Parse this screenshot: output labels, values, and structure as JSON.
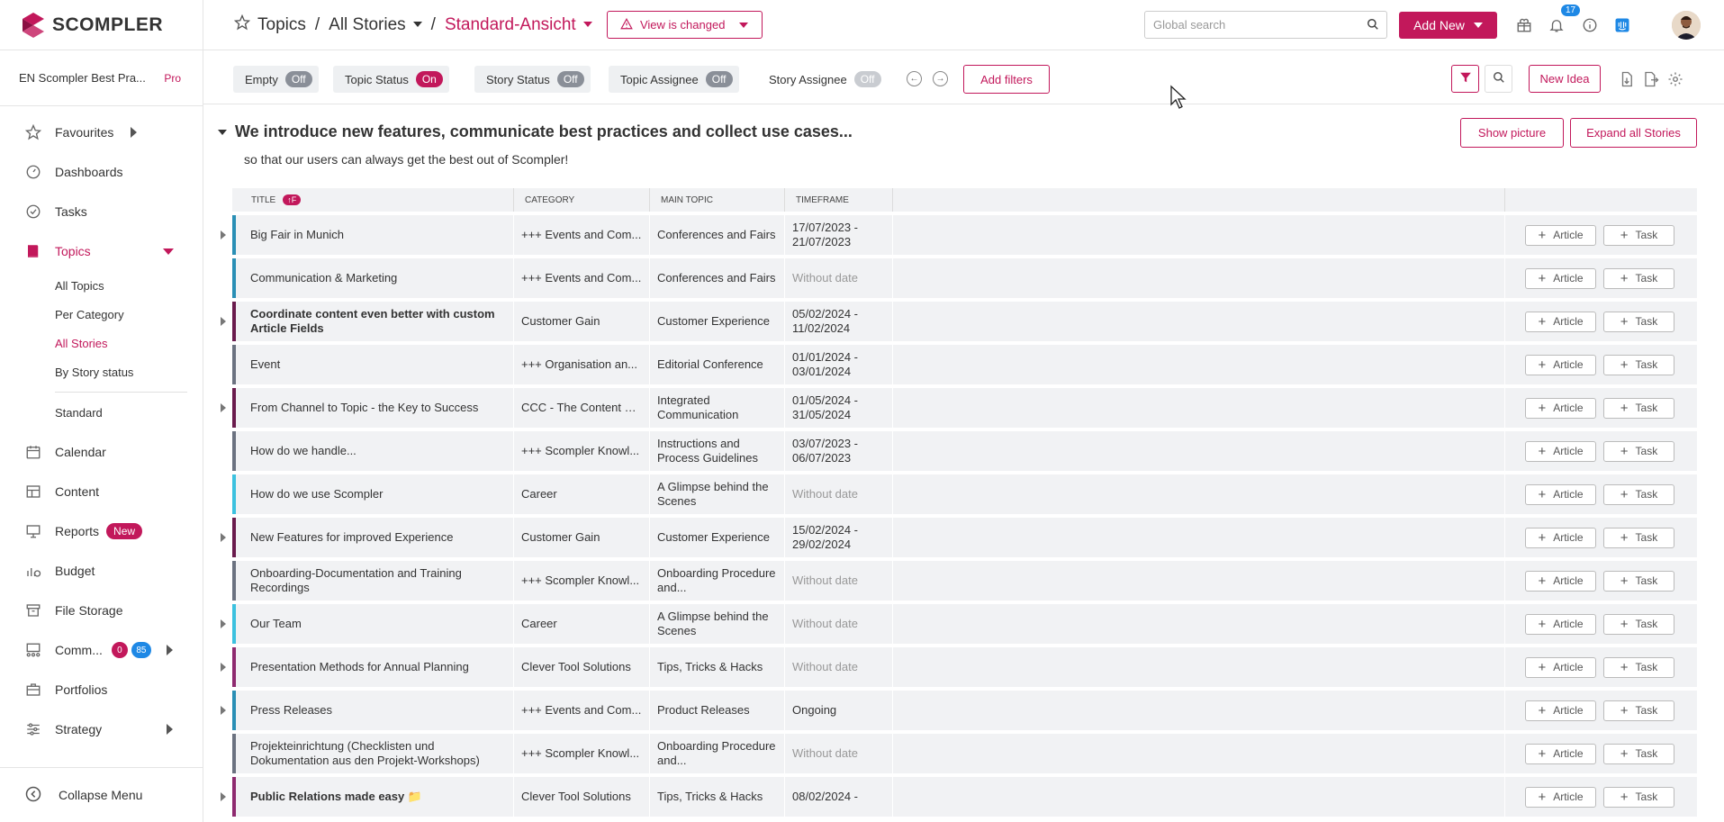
{
  "app": {
    "logo_text": "SCOMPLER"
  },
  "workspace": {
    "name": "EN Scompler Best Pra...",
    "plan": "Pro"
  },
  "sidebar": {
    "items": [
      {
        "label": "Favourites"
      },
      {
        "label": "Dashboards"
      },
      {
        "label": "Tasks"
      },
      {
        "label": "Topics"
      },
      {
        "label": "Calendar"
      },
      {
        "label": "Content"
      },
      {
        "label": "Reports",
        "badge": "New"
      },
      {
        "label": "Budget"
      },
      {
        "label": "File Storage"
      },
      {
        "label": "Comm...",
        "badge_a": "0",
        "badge_b": "85"
      },
      {
        "label": "Portfolios"
      },
      {
        "label": "Strategy"
      }
    ],
    "topics_sub": [
      "All Topics",
      "Per Category",
      "All Stories",
      "By Story status",
      "Standard"
    ],
    "collapse_label": "Collapse Menu"
  },
  "header": {
    "crumb_1": "Topics",
    "sep": "/",
    "crumb_2": "All Stories",
    "crumb_3": "Standard-Ansicht",
    "view_changed": "View is changed",
    "search_placeholder": "Global search",
    "add_new": "Add New",
    "notifications": "17"
  },
  "filters": {
    "chips": [
      {
        "label": "Empty",
        "state": "Off"
      },
      {
        "label": "Topic Status",
        "state": "On"
      },
      {
        "label": "Story Status",
        "state": "Off"
      },
      {
        "label": "Topic Assignee",
        "state": "Off"
      },
      {
        "label": "Story Assignee",
        "state": "Off"
      }
    ],
    "add_filters": "Add filters",
    "new_idea": "New Idea"
  },
  "main": {
    "heading": "We introduce new features, communicate best practices and collect use cases...",
    "subheading": "so that our users can always get the best out of Scompler!",
    "show_picture": "Show picture",
    "expand_all": "Expand all Stories"
  },
  "table": {
    "columns": [
      "TITLE",
      "CATEGORY",
      "MAIN TOPIC",
      "TIMEFRAME"
    ],
    "sort_badge": "↑F",
    "article_label": "Article",
    "task_label": "Task",
    "rows": [
      {
        "title": "Big Fair in Munich",
        "category": "+++ Events and Com...",
        "main": "Conferences and Fairs",
        "time": "17/07/2023 - 21/07/2023",
        "color": "#2a8fb5",
        "expand": true,
        "bold": false
      },
      {
        "title": "Communication & Marketing",
        "category": "+++ Events and Com...",
        "main": "Conferences and Fairs",
        "time": "Without date",
        "color": "#2a8fb5",
        "expand": false,
        "bold": false
      },
      {
        "title": "Coordinate content even better with custom Article Fields",
        "category": "Customer Gain",
        "main": "Customer Experience",
        "time": "05/02/2024 - 11/02/2024",
        "color": "#6a1b4d",
        "expand": true,
        "bold": true
      },
      {
        "title": "Event",
        "category": "+++ Organisation an...",
        "main": "Editorial Conference",
        "time": "01/01/2024 - 03/01/2024",
        "color": "#6b7280",
        "expand": false,
        "bold": false
      },
      {
        "title": "From Channel to Topic - the Key to Success",
        "category": "CCC - The Content C...",
        "main": "Integrated Communication",
        "time": "01/05/2024 - 31/05/2024",
        "color": "#6a1b4d",
        "expand": true,
        "bold": false
      },
      {
        "title": "How do we handle...",
        "category": "+++ Scompler Knowl...",
        "main": "Instructions and Process Guidelines",
        "time": "03/07/2023 - 06/07/2023",
        "color": "#6b7280",
        "expand": false,
        "bold": false
      },
      {
        "title": "How do we use Scompler",
        "category": "Career",
        "main": "A Glimpse behind the Scenes",
        "time": "Without date",
        "color": "#3cc1df",
        "expand": false,
        "bold": false
      },
      {
        "title": "New Features for improved Experience",
        "category": "Customer Gain",
        "main": "Customer Experience",
        "time": "15/02/2024 - 29/02/2024",
        "color": "#6a1b4d",
        "expand": true,
        "bold": false
      },
      {
        "title": "Onboarding-Documentation and Training Recordings",
        "category": "+++ Scompler Knowl...",
        "main": "Onboarding Procedure and...",
        "time": "Without date",
        "color": "#6b7280",
        "expand": false,
        "bold": false
      },
      {
        "title": "Our Team",
        "category": "Career",
        "main": "A Glimpse behind the Scenes",
        "time": "Without date",
        "color": "#3cc1df",
        "expand": true,
        "bold": false
      },
      {
        "title": "Presentation Methods for Annual Planning",
        "category": "Clever Tool Solutions",
        "main": "Tips, Tricks & Hacks",
        "time": "Without date",
        "color": "#8e2a6f",
        "expand": true,
        "bold": false
      },
      {
        "title": "Press Releases",
        "category": "+++ Events and Com...",
        "main": "Product Releases",
        "time": "Ongoing",
        "color": "#2a8fb5",
        "expand": true,
        "bold": false
      },
      {
        "title": "Projekteinrichtung (Checklisten und Dokumentation aus den Projekt-Workshops)",
        "category": "+++ Scompler Knowl...",
        "main": "Onboarding Procedure and...",
        "time": "Without date",
        "color": "#6b7280",
        "expand": false,
        "bold": false
      },
      {
        "title": "Public Relations made easy 📁",
        "category": "Clever Tool Solutions",
        "main": "Tips, Tricks & Hacks",
        "time": "08/02/2024 -",
        "color": "#8e2a6f",
        "expand": true,
        "bold": true
      }
    ]
  }
}
